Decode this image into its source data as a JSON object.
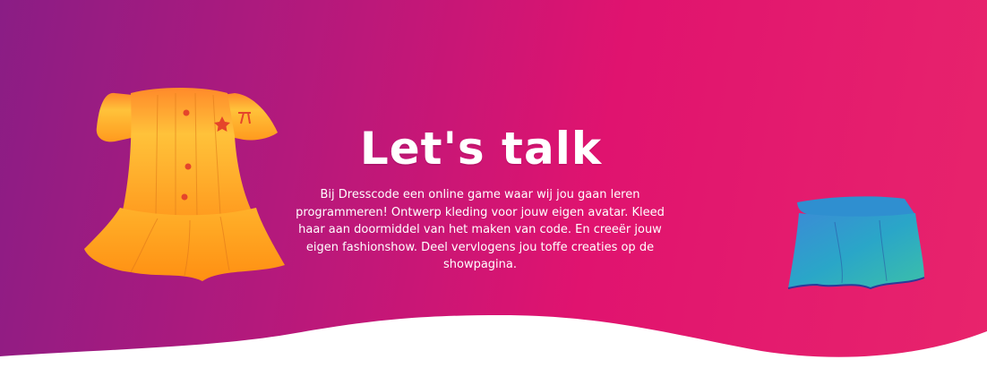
{
  "hero": {
    "title": "Let's talk",
    "description": "Bij Dresscode een online game waar wij jou gaan leren programmeren! Ontwerp kleding voor jouw eigen avatar. Kleed haar aan doormiddel van het maken van code. En creeër jouw eigen fashionshow. Deel vervlogens jou toffe creaties op de showpagina."
  },
  "illustrations": {
    "left": "dress-icon",
    "right": "skirt-icon"
  },
  "colors": {
    "gradient_start": "#8a1d85",
    "gradient_end": "#e8246c",
    "dress": "#ffb52e",
    "skirt": "#2fa7c9",
    "text": "#ffffff"
  }
}
